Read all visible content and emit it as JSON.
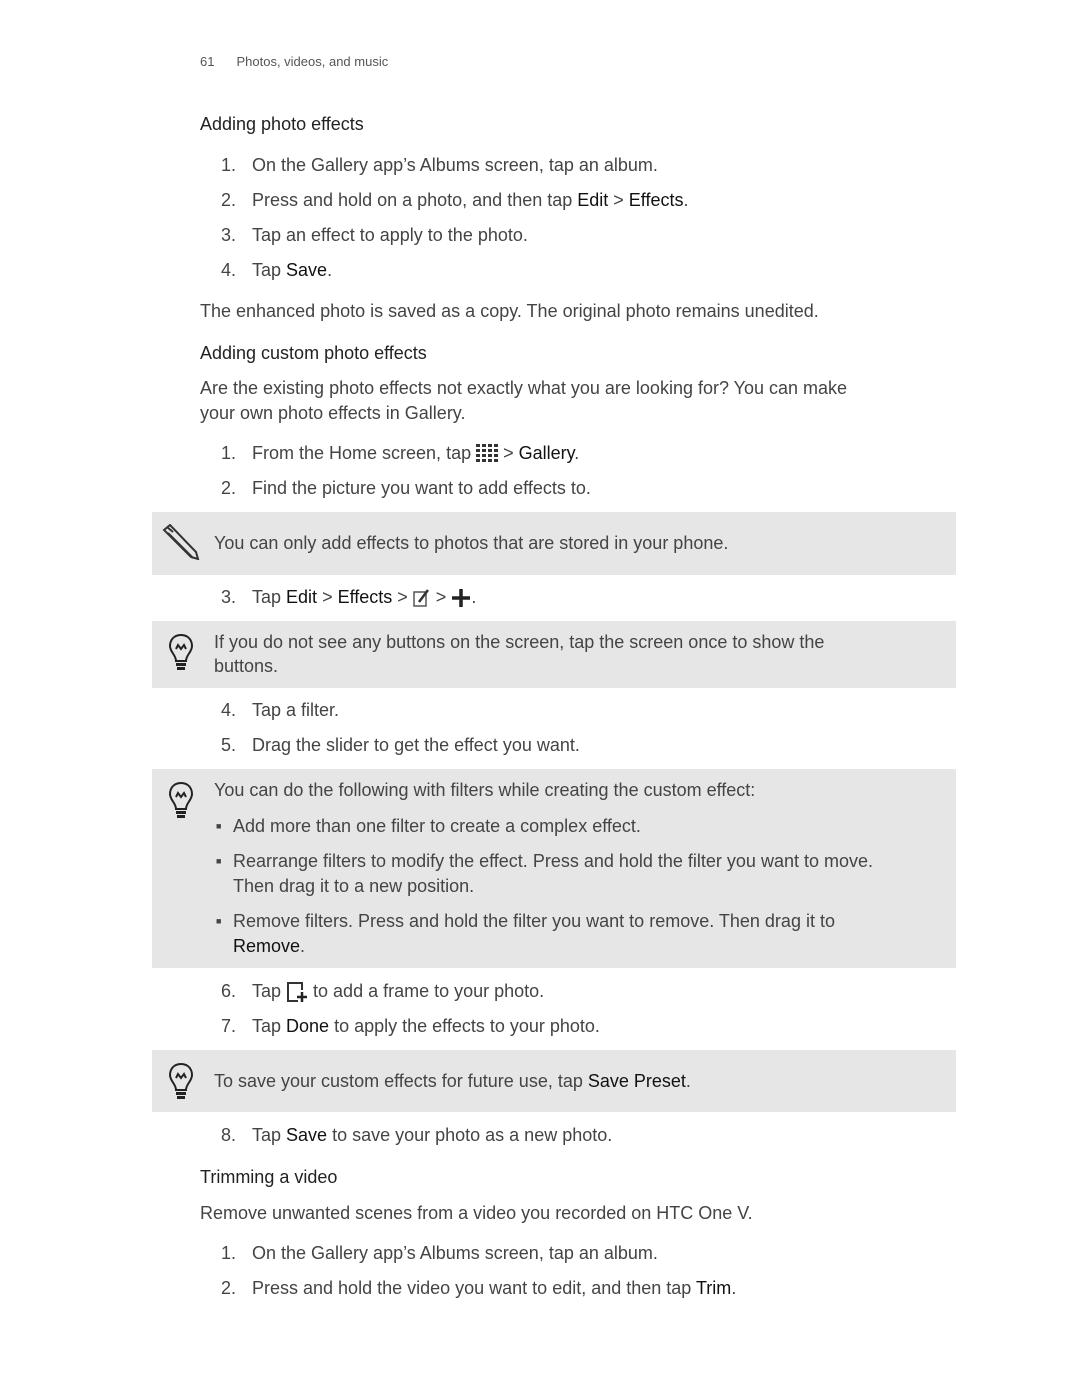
{
  "header": {
    "page_number": "61",
    "section": "Photos, videos, and music"
  },
  "s1": {
    "heading": "Adding photo effects",
    "i1": "On the Gallery app’s Albums screen, tap an album.",
    "i2a": "Press and hold on a photo, and then tap ",
    "i2b": "Edit",
    "i2c": " > ",
    "i2d": "Effects",
    "i2e": ".",
    "i3": "Tap an effect to apply to the photo.",
    "i4a": "Tap ",
    "i4b": "Save",
    "i4c": ".",
    "para": "The enhanced photo is saved as a copy. The original photo remains unedited."
  },
  "s2": {
    "heading": "Adding custom photo effects",
    "para1": "Are the existing photo effects not exactly what you are looking for? You can make",
    "para2": "your own photo effects in Gallery.",
    "i1a": "From the Home screen, tap ",
    "i1b": " > ",
    "i1c": "Gallery",
    "i1d": ".",
    "i2": "Find the picture you want to add effects to.",
    "note": "You can only add effects to photos that are stored in your phone.",
    "i3a": "Tap ",
    "i3b": "Edit",
    "i3c": " > ",
    "i3d": "Effects",
    "i3e": " > ",
    "i3f": " > ",
    "i3g": ".",
    "tip1a": "If you do not see any buttons on the screen, tap the screen once to show the",
    "tip1b": "buttons.",
    "i4": "Tap a filter.",
    "i5": "Drag the slider to get the effect you want.",
    "tip2": "You can do the following with filters while creating the custom effect:",
    "b1": "Add more than one filter to create a complex effect.",
    "b2a": "Rearrange filters to modify the effect. Press and hold the filter you want to move.",
    "b2b": "Then drag it to a new position.",
    "b3a": "Remove filters. Press and hold the filter you want to remove. Then drag it to",
    "b3b": "Remove",
    "b3c": ".",
    "i6a": "Tap ",
    "i6b": " to add a frame to your photo.",
    "i7a": "Tap ",
    "i7b": "Done",
    "i7c": " to apply the effects to your photo.",
    "tip3a": "To save your custom effects for future use, tap ",
    "tip3b": "Save Preset",
    "tip3c": ".",
    "i8a": "Tap ",
    "i8b": "Save",
    "i8c": " to save your photo as a new photo."
  },
  "s3": {
    "heading": "Trimming a video",
    "para": "Remove unwanted scenes from a video you recorded on HTC One V.",
    "i1": "On the Gallery app’s Albums screen, tap an album.",
    "i2a": "Press and hold the video you want to edit, and then tap ",
    "i2b": "Trim",
    "i2c": "."
  },
  "nums": [
    "1.",
    "2.",
    "3.",
    "4.",
    "5.",
    "6.",
    "7.",
    "8."
  ],
  "bullet": "■",
  "icons": {
    "note": "pencil-icon",
    "tip": "lightbulb-icon",
    "apps": "app-grid-icon",
    "edit": "edit-icon",
    "add": "plus-icon",
    "frame": "frame-add-icon"
  },
  "colors": {
    "note_bg": "#e6e6e6",
    "text": "#444444"
  }
}
